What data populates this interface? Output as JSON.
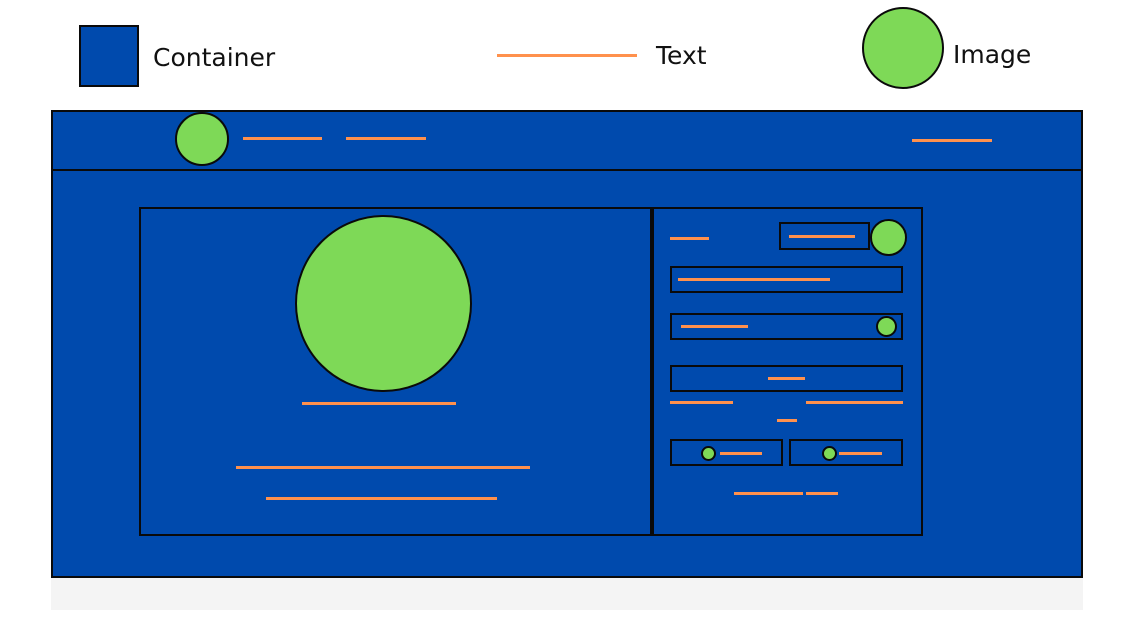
{
  "legend": {
    "container_label": "Container",
    "text_label": "Text",
    "image_label": "Image"
  },
  "colors": {
    "container": "#004aad",
    "text": "#ff914d",
    "image": "#7ed957",
    "border": "#0a0a0a",
    "shadow": "#f4f4f4"
  },
  "wireframe": {
    "header": {
      "logo": "image-placeholder",
      "nav_links": [
        "text-placeholder",
        "text-placeholder"
      ],
      "right_link": "text-placeholder"
    },
    "left_panel": {
      "hero_image": "image-placeholder",
      "caption": "text-placeholder",
      "body_lines": [
        "text-placeholder",
        "text-placeholder"
      ]
    },
    "right_panel": {
      "top_label": "text-placeholder",
      "top_button": "container-with-text",
      "avatar": "image-placeholder",
      "input_1": "container-with-text",
      "input_2": "container-with-text-and-image",
      "submit_button": "container-with-text",
      "social_buttons": [
        "container-with-image-and-text",
        "container-with-image-and-text"
      ]
    }
  }
}
